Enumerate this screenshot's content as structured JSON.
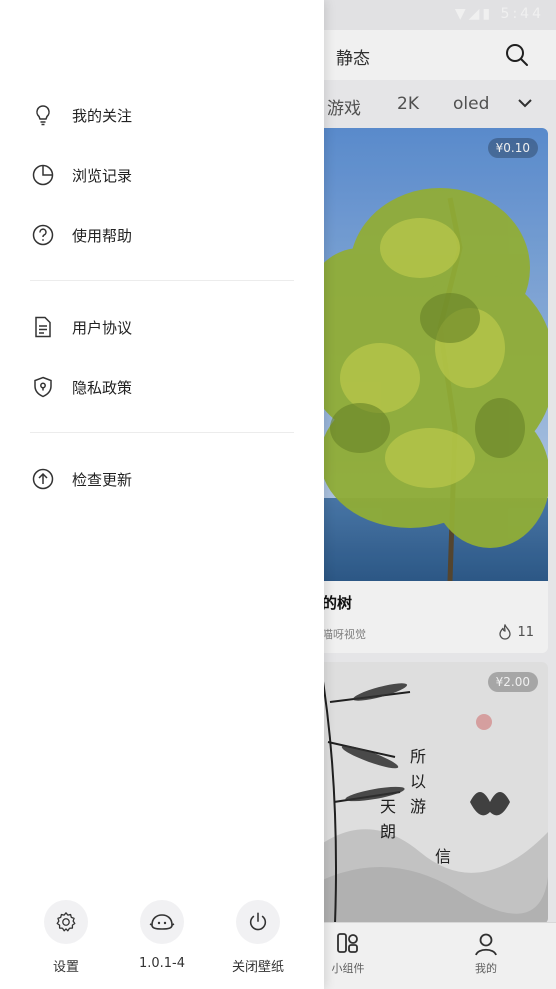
{
  "status_bar": {
    "time": "5:44"
  },
  "header": {
    "tab_label": "静态"
  },
  "categories": [
    "游戏",
    "2K",
    "oled"
  ],
  "cards": [
    {
      "price": "¥0.10",
      "title": "的树",
      "author": "喵呀视觉",
      "likes": "11"
    },
    {
      "price": "¥2.00"
    }
  ],
  "bottom_nav": {
    "widgets_label": "小组件",
    "mine_label": "我的"
  },
  "drawer": {
    "menu_group1": [
      {
        "label": "我的关注",
        "icon": "lightbulb-icon"
      },
      {
        "label": "浏览记录",
        "icon": "pie-chart-icon"
      },
      {
        "label": "使用帮助",
        "icon": "help-icon"
      }
    ],
    "menu_group2": [
      {
        "label": "用户协议",
        "icon": "document-icon"
      },
      {
        "label": "隐私政策",
        "icon": "shield-icon"
      }
    ],
    "menu_group3": [
      {
        "label": "检查更新",
        "icon": "upgrade-icon"
      }
    ],
    "bottom_buttons": [
      {
        "label": "设置",
        "icon": "gear-icon"
      },
      {
        "label": "1.0.1-4",
        "icon": "mascot-icon"
      },
      {
        "label": "关闭壁纸",
        "icon": "power-icon"
      }
    ]
  },
  "colors": {
    "drawer_bg": "#ffffff",
    "page_bg": "#f4f4f6",
    "icon_stroke": "#333333"
  }
}
